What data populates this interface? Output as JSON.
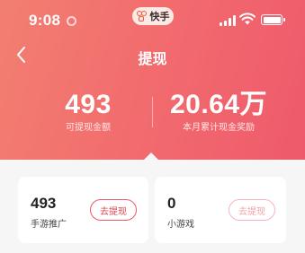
{
  "status_bar": {
    "time": "9:08",
    "app_name": "快手",
    "signal_icon": "cellular-signal-icon",
    "wifi_icon": "wifi-icon",
    "battery_icon": "battery-icon"
  },
  "nav": {
    "back_icon": "chevron-left-icon",
    "title": "提现"
  },
  "summary": {
    "withdrawable_amount": "493",
    "withdrawable_label": "可提现金额",
    "monthly_total": "20.64万",
    "monthly_label": "本月累计现金奖励"
  },
  "cards": [
    {
      "value": "493",
      "label": "手游推广",
      "button": "去提现",
      "button_enabled": true
    },
    {
      "value": "0",
      "label": "小游戏",
      "button": "去提现",
      "button_enabled": false
    }
  ],
  "colors": {
    "accent": "#ee5a6c",
    "button_active": "#e2454f",
    "button_disabled": "#f0a3ab"
  }
}
